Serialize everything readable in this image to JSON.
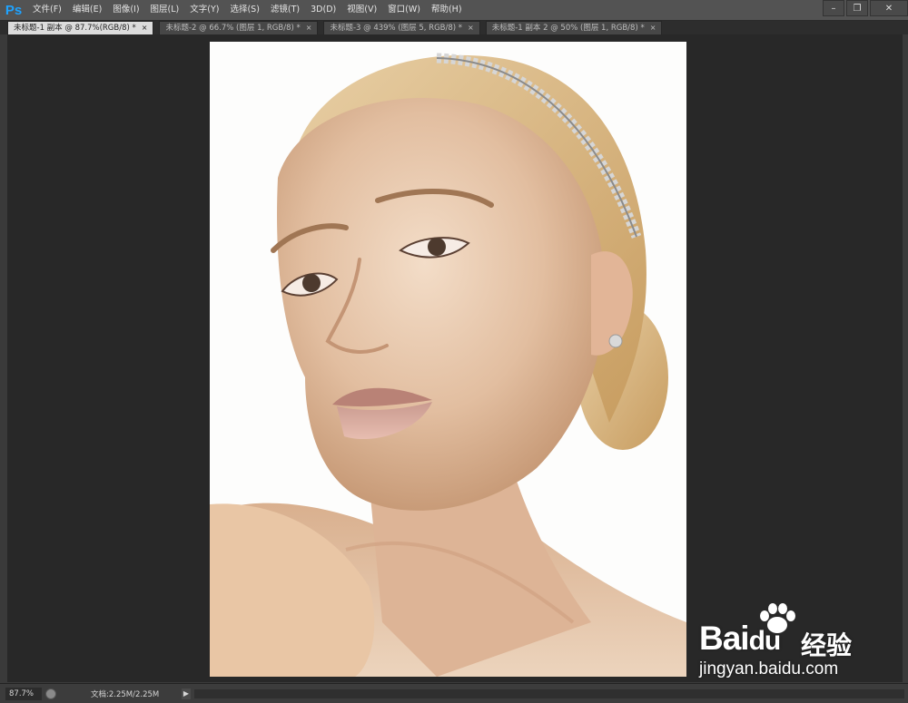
{
  "app": {
    "logo": "Ps"
  },
  "menu": [
    "文件(F)",
    "编辑(E)",
    "图像(I)",
    "图层(L)",
    "文字(Y)",
    "选择(S)",
    "滤镜(T)",
    "3D(D)",
    "视图(V)",
    "窗口(W)",
    "帮助(H)"
  ],
  "window_controls": {
    "minimize": "–",
    "restore": "❐",
    "close": "✕"
  },
  "tabs": [
    {
      "label": "未标题-1 副本 @ 87.7%(RGB/8) *",
      "active": true
    },
    {
      "label": "未标题-2 @ 66.7% (图层 1, RGB/8) *",
      "active": false
    },
    {
      "label": "未标题-3 @ 439% (图层 5, RGB/8) *",
      "active": false
    },
    {
      "label": "未标题-1 副本 2 @ 50% (图层 1, RGB/8) *",
      "active": false
    }
  ],
  "tab_close": "×",
  "status": {
    "zoom": "87.7%",
    "doc_info": "文档:2.25M/2.25M",
    "arrow": "▶"
  },
  "watermark": {
    "brand": "Bai",
    "brand_suffix": "du",
    "cn": "经验",
    "url": "jingyan.baidu.com"
  },
  "colors": {
    "ps_blue": "#1fa3ff",
    "workspace": "#282828",
    "canvas_bg": "#fdfdfc"
  }
}
